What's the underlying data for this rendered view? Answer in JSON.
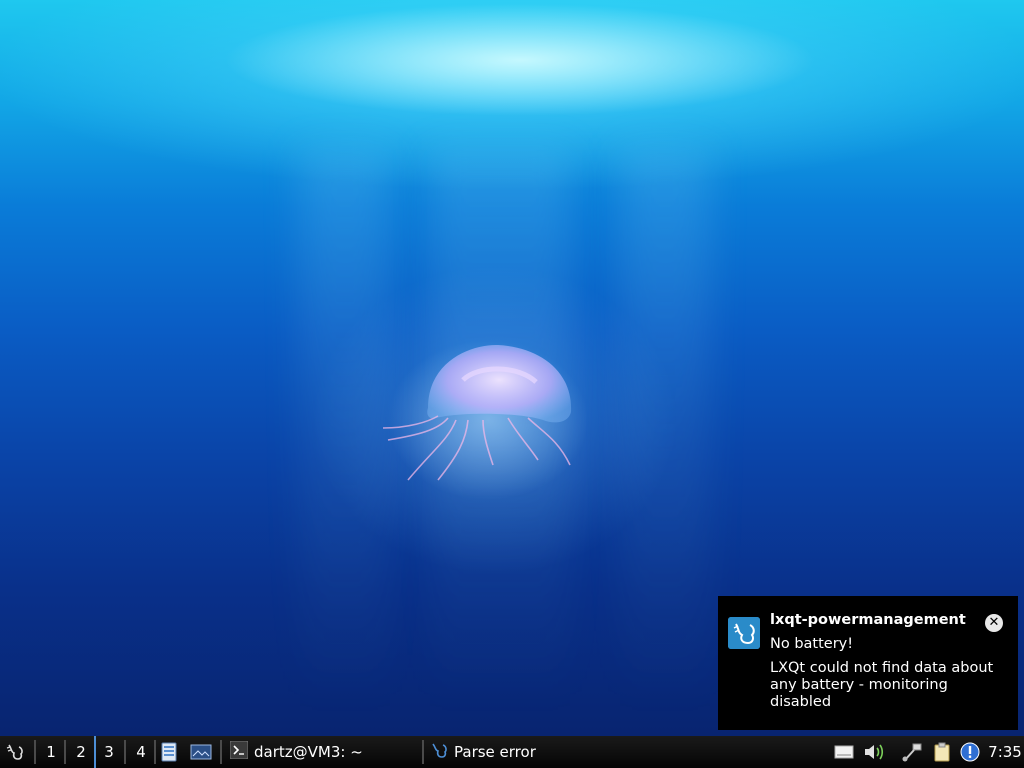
{
  "notification": {
    "title": "lxqt-powermanagement",
    "summary": "No battery!",
    "body": "LXQt could not find data about any battery - monitoring disabled",
    "close_symbol": "✕",
    "icon": "lxqt-logo-icon"
  },
  "taskbar": {
    "menu_icon": "lxqt-menu-icon",
    "desktops": [
      {
        "label": "1"
      },
      {
        "label": "2"
      },
      {
        "label": "3",
        "active": true
      },
      {
        "label": "4"
      }
    ],
    "quicklaunch": [
      {
        "icon": "file-manager-icon"
      },
      {
        "icon": "show-desktop-icon"
      }
    ],
    "tasks": [
      {
        "label": "dartz@VM3: ~",
        "icon": "terminal-icon"
      },
      {
        "label": "Parse error",
        "icon": "lxqt-icon"
      }
    ],
    "tray": [
      {
        "icon": "removable-drive-icon"
      },
      {
        "icon": "volume-icon"
      },
      {
        "icon": "network-icon"
      },
      {
        "icon": "clipboard-icon"
      },
      {
        "icon": "info-icon"
      }
    ],
    "clock": "7:35"
  },
  "colors": {
    "accent": "#4d8fd6",
    "notification_bg": "#000000",
    "taskbar_bg": "#0b0b0b"
  }
}
